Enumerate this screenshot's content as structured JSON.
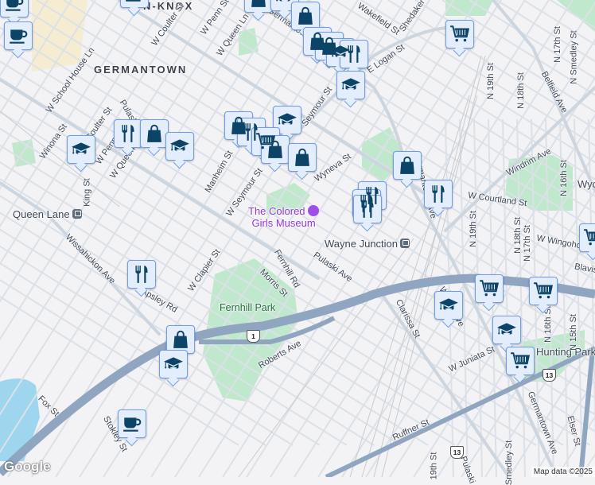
{
  "map": {
    "colors": {
      "background": "#f3f2f4",
      "road": "#d3dae3",
      "highway": "#8fa5c0",
      "park": "#bfe8cc",
      "water": "#9dd6ee",
      "marker_fill": "#e4edfc",
      "marker_border": "#6f9ee6",
      "icon": "#0b4467",
      "poi": "#9334e6"
    },
    "marker_types": [
      "coffee-icon",
      "shopping-bag-icon",
      "restaurant-icon",
      "school-icon",
      "grocery-cart-icon"
    ],
    "labels": {
      "penn_knox": "N-KNOX",
      "germantown": "GERMANTOWN",
      "school_house": "W School House Ln",
      "coulter_top": "W Coulter St",
      "penn_top": "W Penn St",
      "queen_top": "W Queen Ln",
      "germantown_ave_top": "Germantown Ave",
      "wakefield": "Wakefield St",
      "shedaker": "Shedaker St",
      "logan": "E Logan St",
      "seymour_top": "Seymour St",
      "coulter": "Coulter St",
      "pulaski_top": "Pulaski",
      "penn": "W Penn St",
      "queen": "W Queen Ln",
      "winona": "Winona St",
      "king": "King St",
      "manheim": "Manheim St",
      "seymour": "W Seymour St",
      "wyneva": "Wyneva St",
      "wissahickon": "Wissahickon Ave",
      "clapier": "W Clapier St",
      "fernhill_rd": "Fernhill Rd",
      "morris": "Morris St",
      "pulaski": "Pulaski Ave",
      "apsley": "Apsley Rd",
      "roberts": "Roberts Ave",
      "fox": "Fox St",
      "stokley": "Stokley St",
      "germantown_ave": "Germantown Ave",
      "windrim": "Windrim Ave",
      "courtland": "W Courtland St",
      "n19": "N 19th St",
      "n18": "N 18th St",
      "n17": "N 17th St",
      "smedley": "N Smedley St",
      "belfield": "Belfield Ave",
      "n16": "N 16th St",
      "wyc": "Wyc",
      "n19b": "N 19th St",
      "n18b": "N 18th St",
      "n17b": "N 17th St",
      "wingohocking": "W Wingohocking St",
      "blavis": "Blavis St",
      "clarissa": "Clarissa St",
      "wayne": "Wayne Ave",
      "juniata": "W Juniata St",
      "n16b": "N 16th St",
      "n15": "N 15th St",
      "germantown_ave_b": "Germantown Ave",
      "elser": "Elser St",
      "ruffner": "Ruffner St",
      "n19c": "19th St",
      "pulaski_b": "Pulaski",
      "smedley_b": "Smedley St"
    },
    "stations": {
      "queen_lane": "Queen Lane",
      "wayne_junction": "Wayne Junction"
    },
    "poi": {
      "line1": "The Colored",
      "line2": "Girls Museum"
    },
    "parks": {
      "fernhill": "Fernhill Park",
      "hunting": "Hunting Park"
    },
    "routes": {
      "us1": "1",
      "us13a": "13",
      "us13b": "13"
    },
    "attribution": "Map data ©2025",
    "logo": "Google"
  }
}
